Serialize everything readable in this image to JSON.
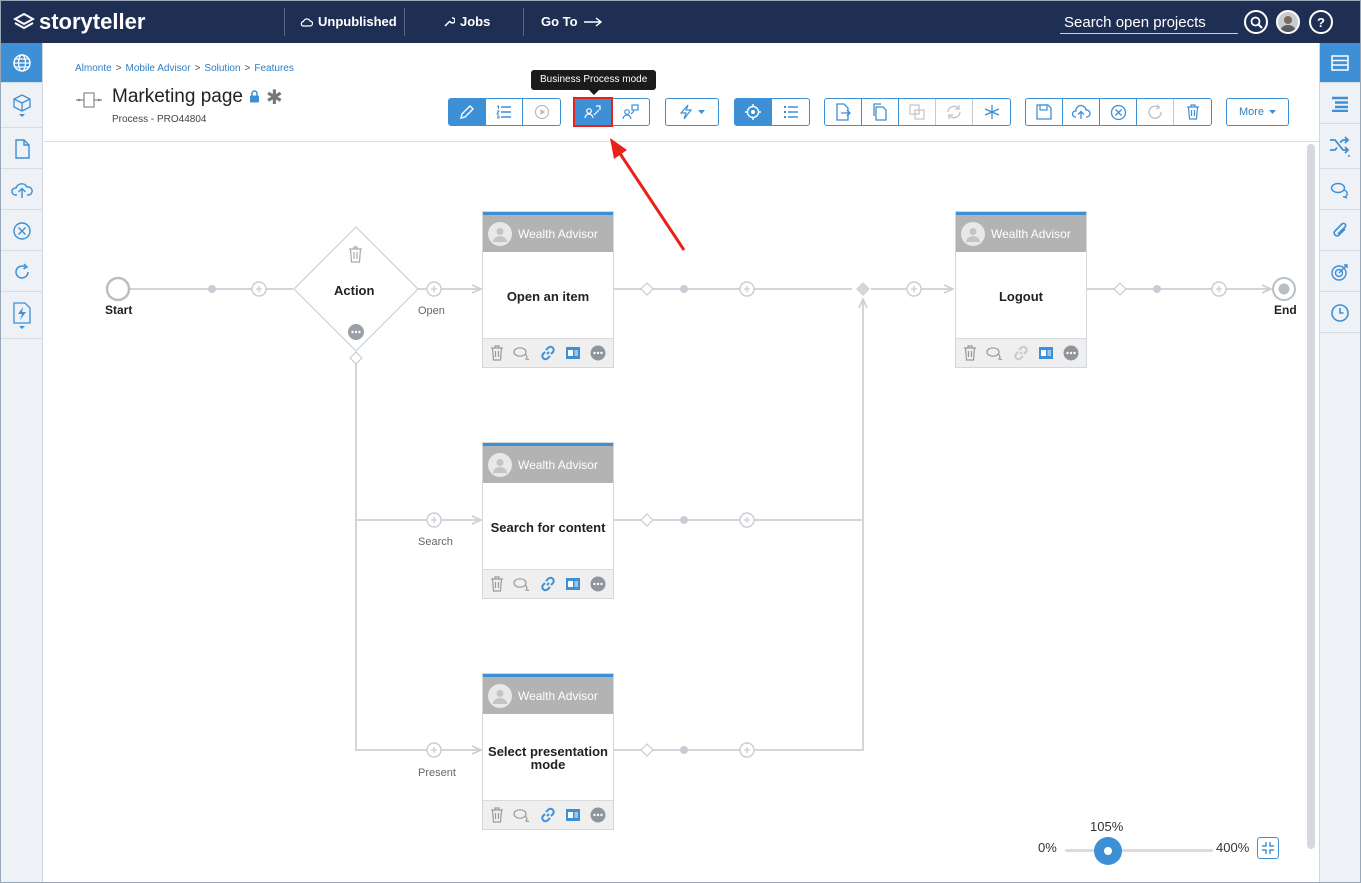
{
  "header": {
    "brand": "storyteller",
    "unpublished": "Unpublished",
    "jobs": "Jobs",
    "goto": "Go To",
    "search_placeholder": "Search open projects"
  },
  "breadcrumb": [
    "Almonte",
    "Mobile Advisor",
    "Solution",
    "Features"
  ],
  "page": {
    "title": "Marketing page",
    "subtitle": "Process - PRO44804"
  },
  "toolbar": {
    "tooltip": "Business Process mode",
    "more_label": "More"
  },
  "flow": {
    "start_label": "Start",
    "end_label": "End",
    "decision_label": "Action",
    "branch_labels": [
      "Open",
      "Search",
      "Present"
    ],
    "tasks": [
      {
        "role": "Wealth Advisor",
        "title": "Open an item"
      },
      {
        "role": "Wealth Advisor",
        "title": "Search for content"
      },
      {
        "role": "Wealth Advisor",
        "title": "Select presentation mode"
      },
      {
        "role": "Wealth Advisor",
        "title": "Logout"
      }
    ]
  },
  "zoom": {
    "min_label": "0%",
    "max_label": "400%",
    "current_label": "105%",
    "level_fraction": 0.262
  },
  "colors": {
    "topbar": "#1f2f54",
    "accent": "#3d8fd6",
    "highlight": "#e8221b"
  }
}
